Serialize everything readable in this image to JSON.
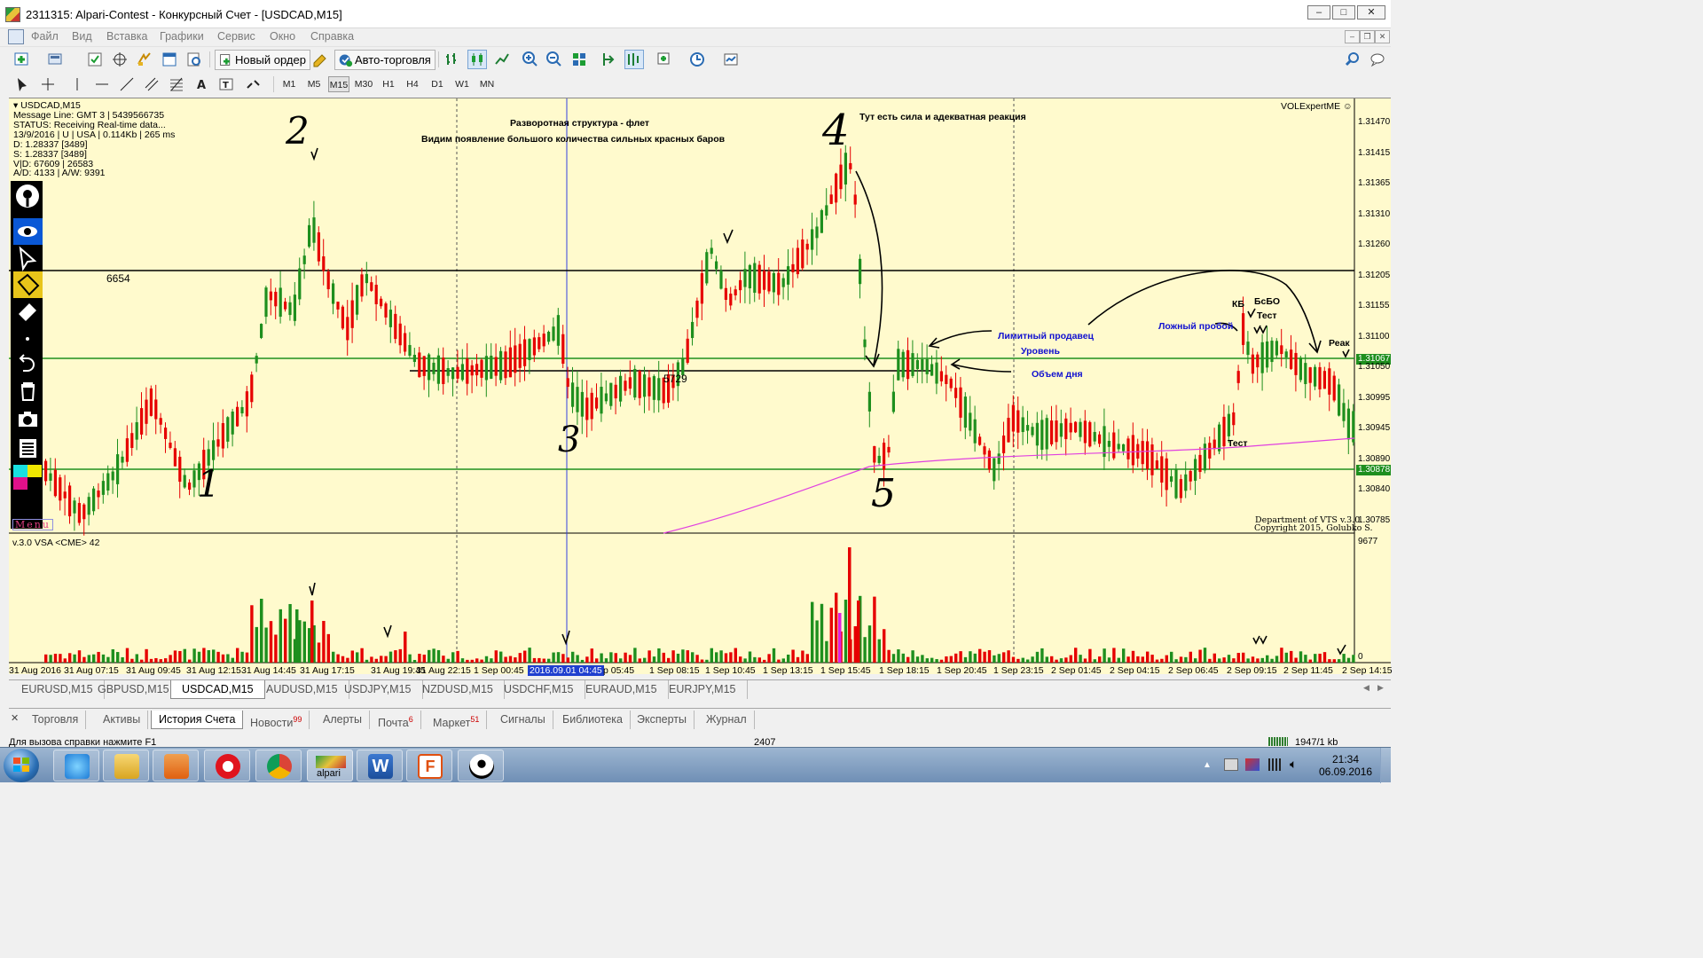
{
  "window": {
    "title": "2311315: Alpari-Contest - Конкурсный Счет - [USDCAD,M15]",
    "controls": [
      "–",
      "□",
      "✕"
    ]
  },
  "menu": [
    "Файл",
    "Вид",
    "Вставка",
    "Графики",
    "Сервис",
    "Окно",
    "Справка"
  ],
  "toolbar": {
    "new_order": "Новый ордер",
    "auto_trading": "Авто-торговля",
    "timeframes": [
      "M1",
      "M5",
      "M15",
      "M30",
      "H1",
      "H4",
      "D1",
      "W1",
      "MN"
    ],
    "active_timeframe": "M15"
  },
  "chart": {
    "symbol_label": "USDCAD,M15",
    "info_lines": [
      "Message Line: GMT 3 | 5439566735",
      "STATUS:  Receiving Real-time data...",
      "13/9/2016 | U | USA | 0.114Kb | 265 ms",
      "D: 1.28337  [3489]",
      "S: 1.28337  [3489]",
      "V|D: 67609 | 26583",
      "A/D: 4133 | A/W: 9391"
    ],
    "expert_label": "VOLExpertME ☺",
    "copyright_1": "Department of VTS  v.3.0",
    "copyright_2": "Copyright 2015, Golubko S.",
    "annotations": {
      "top_1": "Разворотная структура - флет",
      "top_2": "Видим появление большого количества сильных красных баров",
      "top_3": "Тут есть сила и адекватная реакция",
      "limit_seller": "Лимитный продавец",
      "level": "Уровень",
      "day_volume": "Объем дня",
      "false_break": "Ложный пробой",
      "kb": "КБ",
      "bsbo": "БсБО",
      "test1": "Тест",
      "test2": "Тест",
      "reak": "Реак",
      "level_6654": "6654",
      "level_5729": "5729",
      "num_1": "1",
      "num_2": "2",
      "num_3": "3",
      "num_4": "4",
      "num_5": "5"
    },
    "price_ticks": [
      "1.31470",
      "1.31415",
      "1.31365",
      "1.31310",
      "1.31260",
      "1.31205",
      "1.31155",
      "1.31100",
      "1.31050",
      "1.30995",
      "1.30945",
      "1.30890",
      "1.30840",
      "1.30785"
    ],
    "price_badges": [
      "1.31067",
      "1.30878"
    ],
    "volume_label": "v.3.0 VSA <CME> 42",
    "volume_ticks": [
      "9677",
      "0"
    ],
    "time_ticks": [
      "31 Aug 2016",
      "31 Aug 07:15",
      "31 Aug 09:45",
      "31 Aug 12:15",
      "31 Aug 14:45",
      "31 Aug 17:15",
      "31 Aug 19:45",
      "31 Aug 22:15",
      "1 Sep 00:45",
      "2016.09.01 04:45",
      "p 05:45",
      "1 Sep 08:15",
      "1 Sep 10:45",
      "1 Sep 13:15",
      "1 Sep 15:45",
      "1 Sep 18:15",
      "1 Sep 20:45",
      "1 Sep 23:15",
      "2 Sep 01:45",
      "2 Sep 04:15",
      "2 Sep 06:45",
      "2 Sep 09:15",
      "2 Sep 11:45",
      "2 Sep 14:15"
    ],
    "menu_label": "Menu"
  },
  "symbol_tabs": [
    "EURUSD,M15",
    "GBPUSD,M15",
    "USDCAD,M15",
    "AUDUSD,M15",
    "USDJPY,M15",
    "NZDUSD,M15",
    "USDCHF,M15",
    "EURAUD,M15",
    "EURJPY,M15"
  ],
  "active_symbol_tab": "USDCAD,M15",
  "terminal_tabs": [
    {
      "label": "Торговля",
      "badge": ""
    },
    {
      "label": "Активы",
      "badge": ""
    },
    {
      "label": "История Счета",
      "badge": ""
    },
    {
      "label": "Новости",
      "badge": "99"
    },
    {
      "label": "Алерты",
      "badge": ""
    },
    {
      "label": "Почта",
      "badge": "6"
    },
    {
      "label": "Маркет",
      "badge": "51"
    },
    {
      "label": "Сигналы",
      "badge": ""
    },
    {
      "label": "Библиотека",
      "badge": ""
    },
    {
      "label": "Эксперты",
      "badge": ""
    },
    {
      "label": "Журнал",
      "badge": ""
    }
  ],
  "status": {
    "help": "Для вызова справки нажмите F1",
    "bars": "2407",
    "traffic": "1947/1 kb"
  },
  "taskbar": {
    "apps": [
      "start",
      "ie",
      "explorer",
      "media",
      "opera",
      "chrome",
      "alpari",
      "word",
      "fx",
      "vts"
    ],
    "alpari_label": "alpari",
    "time": "21:34",
    "date": "06.09.2016"
  },
  "colors": {
    "bull": "#1e8f1e",
    "bear": "#e60000",
    "chart_bg": "#fffacd",
    "annotation_blue": "#1010d0",
    "ma": "#e040e0"
  }
}
